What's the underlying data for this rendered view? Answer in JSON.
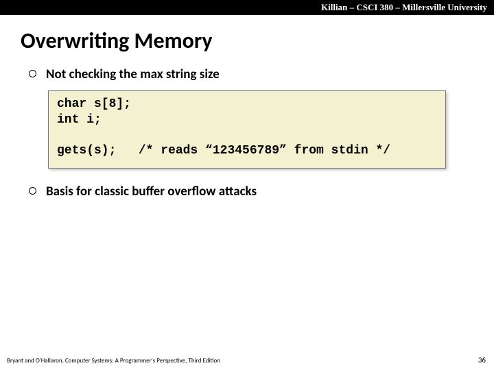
{
  "header": "Killian – CSCI 380 – Millersville University",
  "title": "Overwriting Memory",
  "bullets": [
    "Not checking the max string size",
    "Basis for classic buffer overflow attacks"
  ],
  "code": "char s[8];\nint i;\n\ngets(s);   /* reads “123456789” from stdin */",
  "footer_left": "Bryant and O'Hallaron, Computer Systems: A Programmer's Perspective, Third Edition",
  "page_number": "36"
}
